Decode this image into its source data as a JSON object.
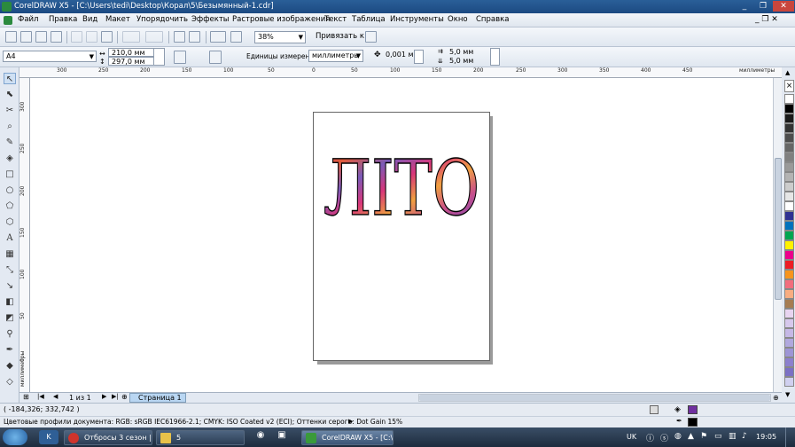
{
  "window": {
    "title": "CorelDRAW X5 - [C:\\Users\\tedi\\Desktop\\Корал\\5\\Безымянный-1.cdr]",
    "minimize": "_",
    "restore": "❐",
    "close": "✕"
  },
  "menu": {
    "items": [
      "Файл",
      "Правка",
      "Вид",
      "Макет",
      "Упорядочить",
      "Эффекты",
      "Растровые изображения",
      "Текст",
      "Таблица",
      "Инструменты",
      "Окно",
      "Справка"
    ],
    "doc_controls": "_ ❐ ✕"
  },
  "toolbar": {
    "zoom": "38%",
    "snap": "Привязать к"
  },
  "property_bar": {
    "paper_size": "A4",
    "width": "210,0 мм",
    "height": "297,0 мм",
    "units_label": "Единицы измерения:",
    "units": "миллиметры",
    "nudge": "0,001 мм",
    "dup_x": "5,0 мм",
    "dup_y": "5,0 мм"
  },
  "ruler": {
    "top_ticks": [
      "300",
      "250",
      "200",
      "150",
      "100",
      "50",
      "0",
      "50",
      "100",
      "150",
      "200",
      "250",
      "300",
      "350",
      "400",
      "450"
    ],
    "top_unit": "миллиметры",
    "left_ticks": [
      "300",
      "250",
      "200",
      "150",
      "100",
      "50",
      "0"
    ],
    "left_unit": "миллиметры"
  },
  "canvas": {
    "artwork_text": "ЛІТО"
  },
  "pages": {
    "counter": "1 из 1",
    "tab": "Страница 1"
  },
  "status": {
    "coords": "( -184,326; 332,742 )",
    "profiles": "Цветовые профили документа: RGB: sRGB IEC61966-2.1; CMYK: ISO Coated v2 (ECI); Оттенки серого: Dot Gain 15%"
  },
  "palette": [
    "#ffffff",
    "#000000",
    "#1a1a1a",
    "#333333",
    "#4d4d4d",
    "#666666",
    "#808080",
    "#999999",
    "#b3b3b3",
    "#cccccc",
    "#e6e6e6",
    "#ffffff",
    "#2e3192",
    "#0072bc",
    "#00a651",
    "#fff200",
    "#ec008c",
    "#ed1c24",
    "#f7941d",
    "#f26d7d",
    "#f9ad81",
    "#a67c52",
    "#e8d4f0",
    "#d6c8ec",
    "#c5b8e6",
    "#b0a8de",
    "#9d95d6",
    "#8c80ce",
    "#7b70c4",
    "#d0d0f0"
  ],
  "colors": {
    "fill": "#7030a0",
    "outline": "#000000"
  },
  "taskbar": {
    "lang": "UK",
    "time": "19:05",
    "tasks": [
      {
        "label": "Отбросы 3 сезон | С...",
        "color": "#d0342c"
      },
      {
        "label": "5",
        "color": "#e8c24a"
      },
      {
        "label": "CorelDRAW X5 - [C:\\...",
        "color": "#3a9a3a"
      }
    ]
  }
}
